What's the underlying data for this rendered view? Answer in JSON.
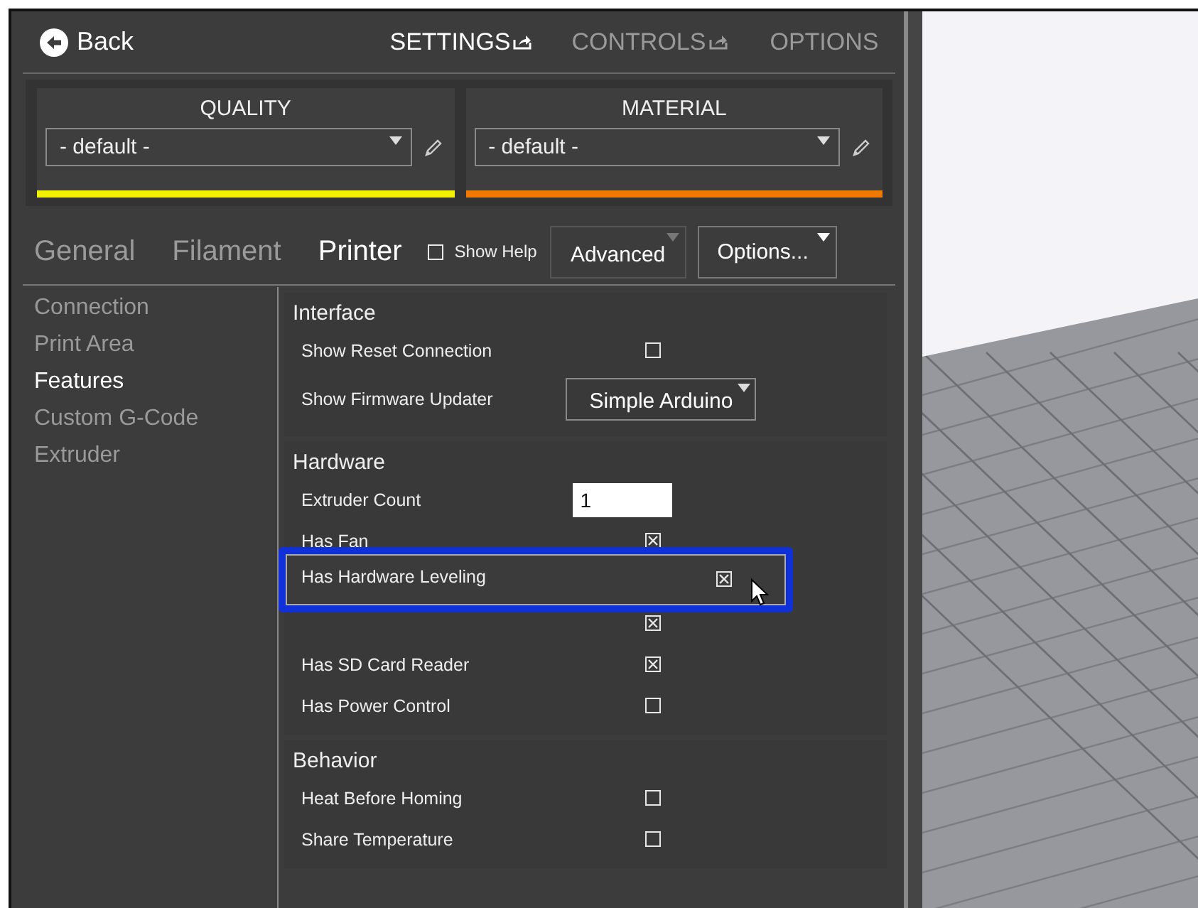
{
  "header": {
    "back": "Back",
    "tabs": [
      {
        "label": "SETTINGS",
        "selected": true,
        "external": true
      },
      {
        "label": "CONTROLS",
        "selected": false,
        "external": true
      },
      {
        "label": "OPTIONS",
        "selected": false,
        "external": false
      }
    ]
  },
  "profiles": [
    {
      "title": "QUALITY",
      "value": "- default -",
      "color": "#f2f200"
    },
    {
      "title": "MATERIAL",
      "value": "- default -",
      "color": "#f07a00"
    }
  ],
  "settings_tabs": [
    {
      "label": "General",
      "selected": false
    },
    {
      "label": "Filament",
      "selected": false
    },
    {
      "label": "Printer",
      "selected": true
    }
  ],
  "show_help": {
    "label": "Show Help",
    "checked": false
  },
  "mode_dropdown": "Advanced",
  "options_button": "Options...",
  "sidebar": {
    "items": [
      {
        "label": "Connection",
        "selected": false
      },
      {
        "label": "Print Area",
        "selected": false
      },
      {
        "label": "Features",
        "selected": true
      },
      {
        "label": "Custom G-Code",
        "selected": false
      },
      {
        "label": "Extruder",
        "selected": false
      }
    ]
  },
  "sections": [
    {
      "title": "Interface",
      "rows": [
        {
          "kind": "checkbox",
          "label": "Show Reset Connection",
          "checked": false,
          "highlighted": false
        },
        {
          "kind": "dropdown",
          "label": "Show Firmware Updater",
          "value": "Simple Arduino",
          "highlighted": false
        }
      ]
    },
    {
      "title": "Hardware",
      "rows": [
        {
          "kind": "number",
          "label": "Extruder Count",
          "value": "1",
          "highlighted": false
        },
        {
          "kind": "checkbox",
          "label": "Has Fan",
          "checked": true,
          "highlighted": false
        },
        {
          "kind": "checkbox",
          "label": "Has Hardware Leveling",
          "checked": true,
          "highlighted": true
        },
        {
          "kind": "checkbox",
          "checked": true,
          "highlighted": false
        },
        {
          "kind": "checkbox",
          "label": "Has SD Card Reader",
          "checked": true,
          "highlighted": false
        },
        {
          "kind": "checkbox",
          "label": "Has Power Control",
          "checked": false,
          "highlighted": false
        }
      ]
    },
    {
      "title": "Behavior",
      "rows": [
        {
          "kind": "checkbox",
          "label": "Heat Before Homing",
          "checked": false,
          "highlighted": false
        },
        {
          "kind": "checkbox",
          "label": "Share Temperature",
          "checked": false,
          "highlighted": false
        }
      ]
    }
  ]
}
